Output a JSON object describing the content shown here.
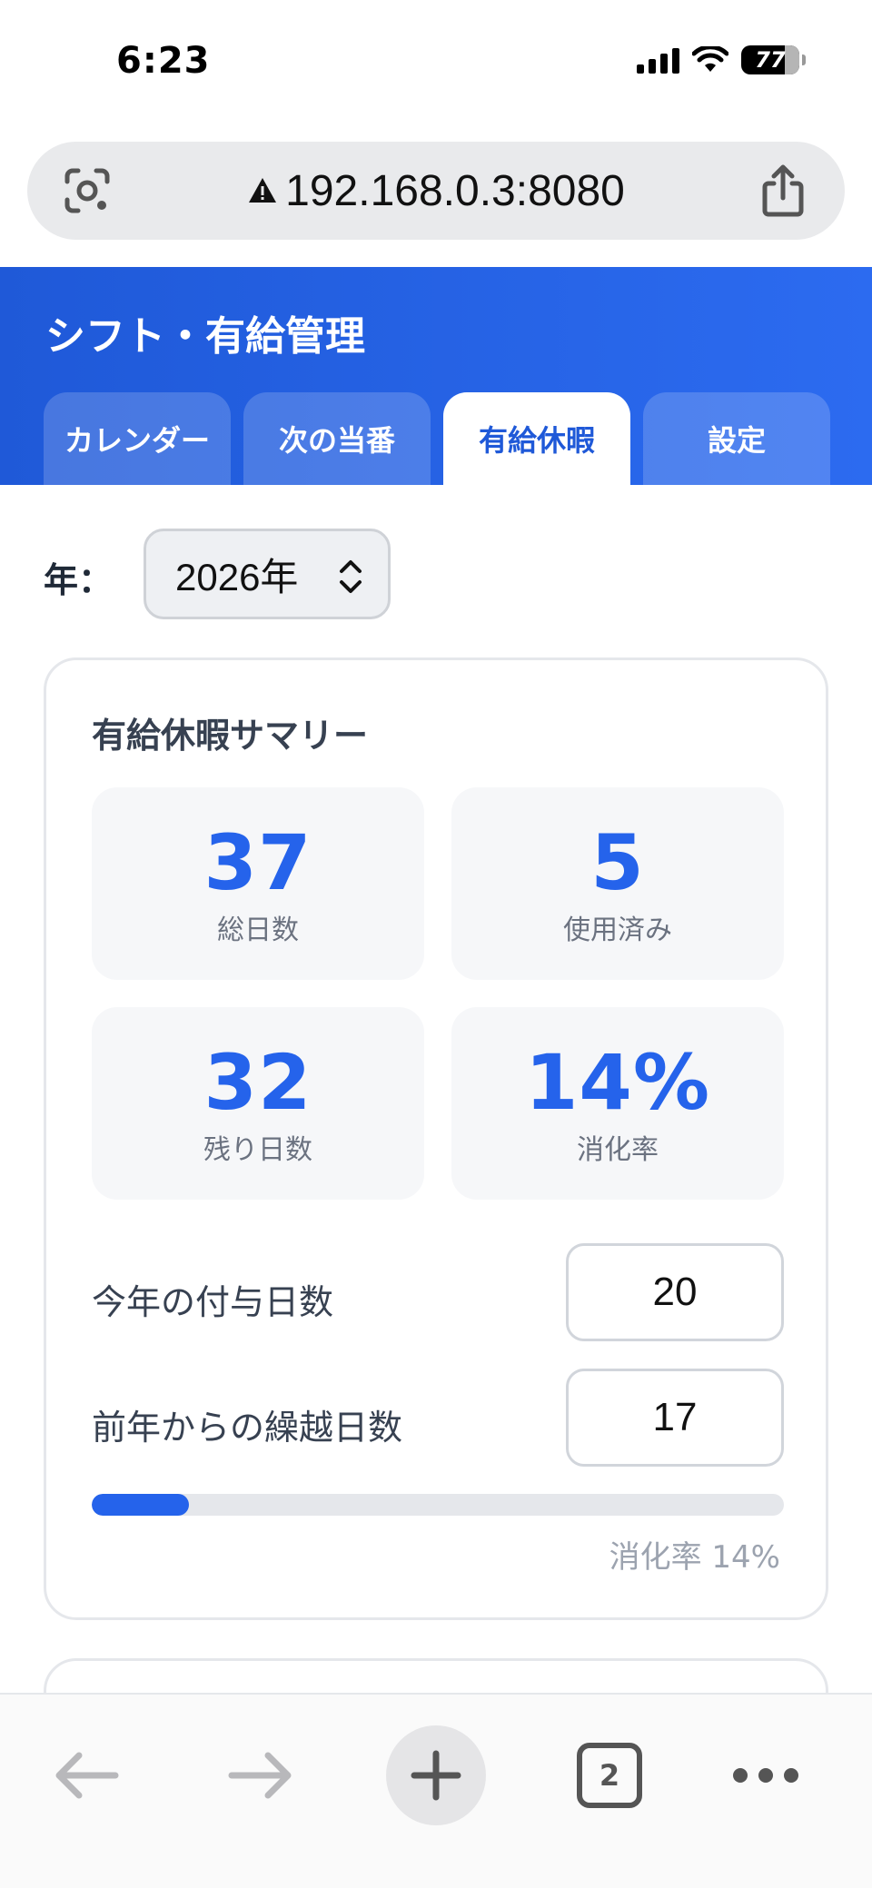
{
  "status_bar": {
    "time": "6:23",
    "battery": "77"
  },
  "browser": {
    "url": "192.168.0.3:8080",
    "tab_count": "2"
  },
  "app": {
    "title": "シフト・有給管理",
    "tabs": [
      {
        "label": "カレンダー",
        "active": false
      },
      {
        "label": "次の当番",
        "active": false
      },
      {
        "label": "有給休暇",
        "active": true
      },
      {
        "label": "設定",
        "active": false
      }
    ]
  },
  "year": {
    "label": "年：",
    "value": "2026年"
  },
  "summary": {
    "title": "有給休暇サマリー",
    "stats": [
      {
        "value": "37",
        "label": "総日数"
      },
      {
        "value": "5",
        "label": "使用済み"
      },
      {
        "value": "32",
        "label": "残り日数"
      },
      {
        "value": "14%",
        "label": "消化率"
      }
    ],
    "granted": {
      "label": "今年の付与日数",
      "value": "20"
    },
    "carried": {
      "label": "前年からの繰越日数",
      "value": "17"
    },
    "progress": {
      "percent": 14,
      "text": "消化率 14%"
    }
  },
  "colors": {
    "accent": "#2563eb",
    "header": "#1f59d8"
  }
}
